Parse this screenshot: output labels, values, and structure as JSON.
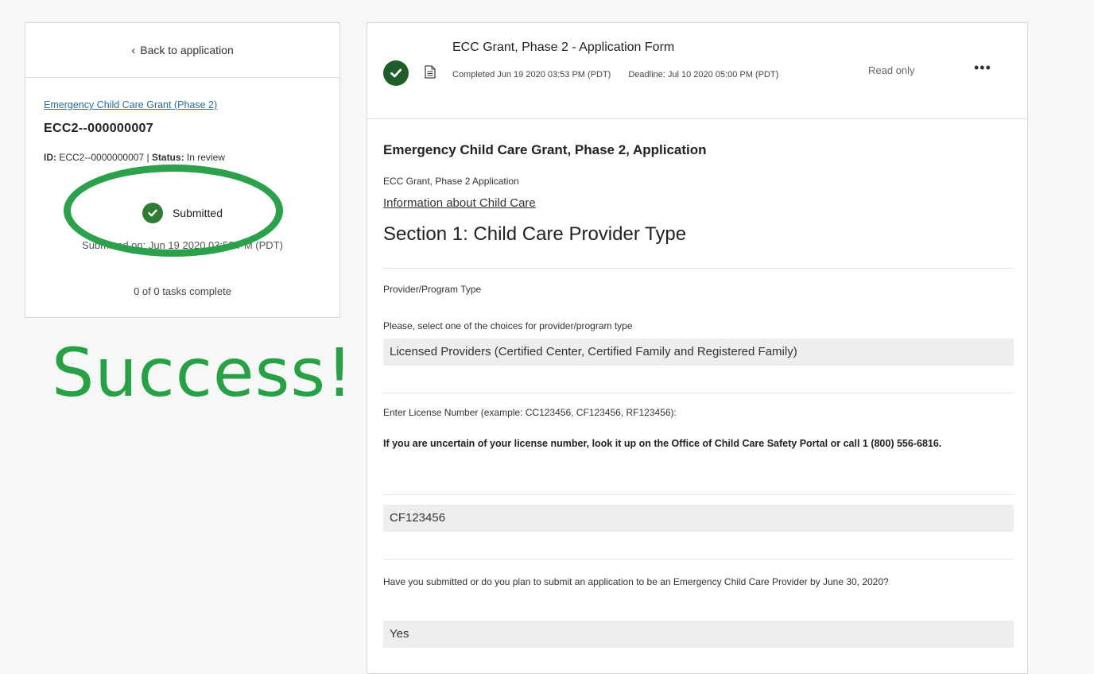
{
  "sidebar": {
    "back_label": "Back to application",
    "app_link": "Emergency Child Care Grant (Phase 2)",
    "app_code": "ECC2--000000007",
    "id_label": "ID:",
    "id_value": "ECC2--0000000007",
    "status_label": "Status:",
    "status_value": "In review",
    "submitted_label": "Submitted",
    "submitted_on": "Submitted on: Jun 19 2020 03:53 PM (PDT)",
    "tasks": "0 of 0 tasks complete"
  },
  "annotation": {
    "text": "Success!",
    "color": "#27a046"
  },
  "form_header": {
    "title": "ECC Grant, Phase 2 - Application Form",
    "completed": "Completed Jun 19 2020 03:53 PM (PDT)",
    "deadline": "Deadline: Jul 10 2020 05:00 PM (PDT)",
    "read_only": "Read only",
    "more": "•••"
  },
  "form": {
    "heading": "Emergency Child Care Grant, Phase 2, Application",
    "subheading": "ECC Grant, Phase 2 Application",
    "info_link": "Information about Child Care",
    "section_title": "Section 1: Child Care Provider Type",
    "q1_label": "Provider/Program Type",
    "q1_prompt": "Please, select one of the choices for provider/program type",
    "q1_answer": "Licensed Providers (Certified Center, Certified Family and Registered Family)",
    "q2_label": "Enter License Number (example: CC123456, CF123456, RF123456):",
    "q2_help": "If you are uncertain of your license number, look it up on the Office of Child Care Safety Portal or call 1 (800) 556-6816.",
    "q2_answer": "CF123456",
    "q3_prompt": "Have you submitted or do you plan to submit an application to be an Emergency Child Care Provider by June 30, 2020?",
    "q3_answer": "Yes"
  },
  "colors": {
    "check_dark": "#1f5e2a",
    "check_green": "#2e7d32",
    "link": "#2a6ea3"
  }
}
